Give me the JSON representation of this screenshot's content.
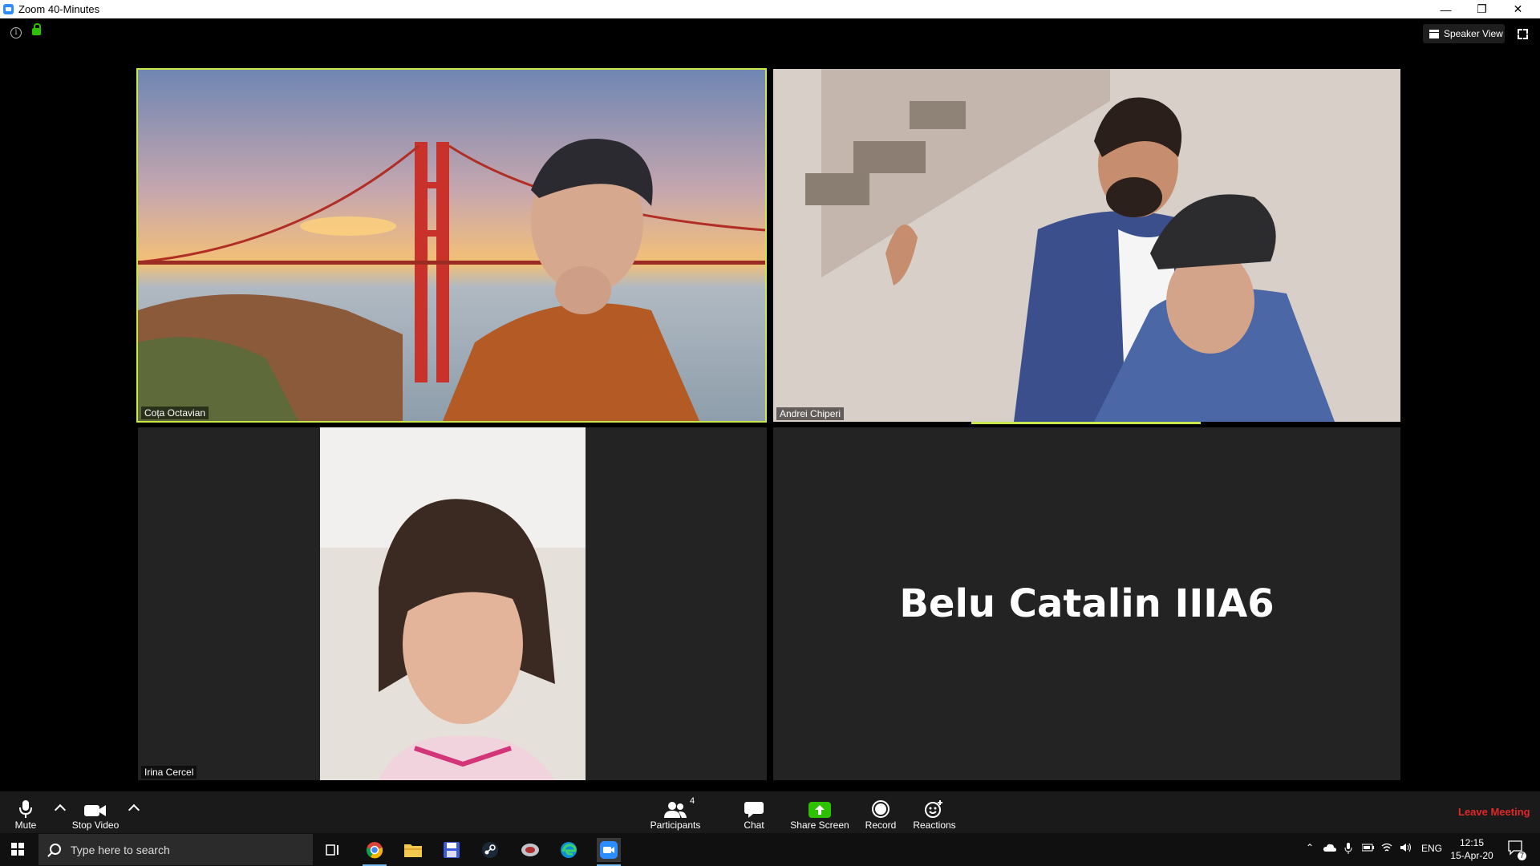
{
  "window": {
    "title": "Zoom 40-Minutes"
  },
  "header": {
    "speaker_view_label": "Speaker View"
  },
  "participants_tiles": [
    {
      "name": "Coța Octavian"
    },
    {
      "name": "Andrei Chiperi"
    },
    {
      "name": "Irina Cercel"
    },
    {
      "name": "Belu Catalin IIIA6"
    }
  ],
  "toolbar": {
    "mute_label": "Mute",
    "stop_video_label": "Stop Video",
    "participants_label": "Participants",
    "participants_count": "4",
    "chat_label": "Chat",
    "share_screen_label": "Share Screen",
    "record_label": "Record",
    "reactions_label": "Reactions",
    "leave_label": "Leave Meeting"
  },
  "taskbar": {
    "search_placeholder": "Type here to search",
    "language": "ENG",
    "time": "12:15",
    "date": "15-Apr-20",
    "notification_count": "7"
  },
  "colors": {
    "active_speaker": "#c9e84a",
    "leave": "#e02828",
    "share": "#2DC100",
    "zoom_blue": "#2D8CFF"
  }
}
